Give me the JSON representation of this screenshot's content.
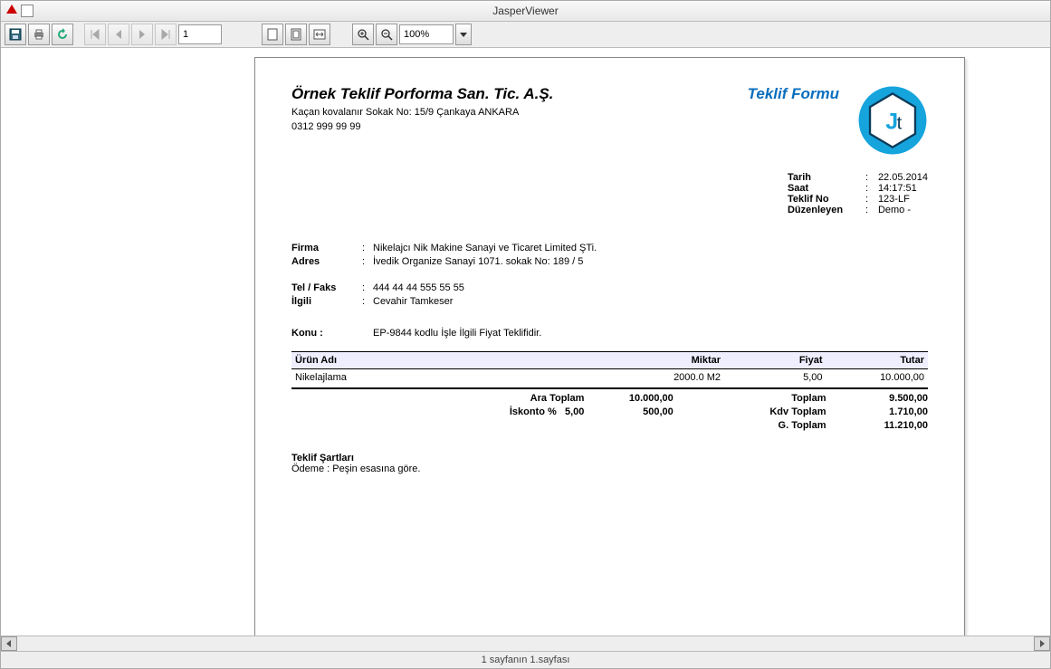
{
  "window": {
    "title": "JasperViewer"
  },
  "toolbar": {
    "page_value": "1",
    "zoom_value": "100%"
  },
  "status": "1 sayfanın 1.sayfası",
  "doc": {
    "company": "Örnek Teklif Porforma San. Tic. A.Ş.",
    "addr1": "Kaçan kovalanır Sokak No: 15/9 Çankaya ANKARA",
    "addr2": "0312 999 99 99",
    "form_title": "Teklif Formu",
    "meta": {
      "date_k": "Tarih",
      "date_v": "22.05.2014",
      "time_k": "Saat",
      "time_v": "14:17:51",
      "no_k": "Teklif No",
      "no_v": "123-LF",
      "by_k": "Düzenleyen",
      "by_v": "Demo  -"
    },
    "client": {
      "firm_k": "Firma",
      "firm_v": "Nikelajcı Nik Makine Sanayi ve Ticaret Limited ŞTi.",
      "addr_k": "Adres",
      "addr_v": "İvedik Organize Sanayi 1071. sokak No: 189 / 5",
      "tel_k": "Tel / Faks",
      "tel_v": "444 44 44 555 55 55",
      "ilgili_k": "İlgili",
      "ilgili_v": "Cevahir Tamkeser",
      "konu_k": "Konu :",
      "konu_v": "EP-9844 kodlu İşle İlgili Fiyat Teklifidir."
    },
    "table": {
      "h_name": "Ürün Adı",
      "h_qty": "Miktar",
      "h_price": "Fiyat",
      "h_total": "Tutar",
      "r1_name": "Nikelajlama",
      "r1_qty": "2000.0 M2",
      "r1_price": "5,00",
      "r1_total": "10.000,00"
    },
    "sums": {
      "ara_k": "Ara Toplam",
      "ara_v": "10.000,00",
      "isk_k": "İskonto %",
      "isk_p": "5,00",
      "isk_v": "500,00",
      "top_k": "Toplam",
      "top_v": "9.500,00",
      "kdv_k": "Kdv Toplam",
      "kdv_v": "1.710,00",
      "g_k": "G. Toplam",
      "g_v": "11.210,00"
    },
    "terms_h": "Teklif Şartları",
    "terms_1": "Ödeme : Peşin esasına göre."
  }
}
